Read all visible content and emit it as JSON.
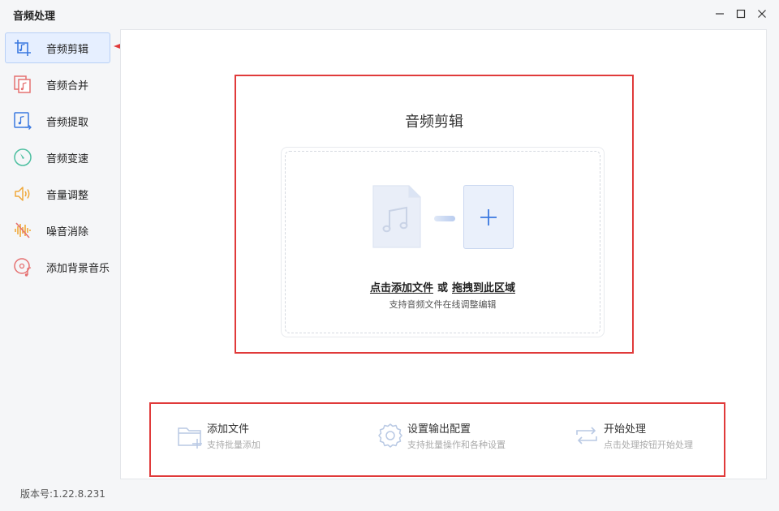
{
  "app": {
    "title": "音频处理"
  },
  "window_controls": {
    "minimize": "minimize-icon",
    "maximize": "maximize-icon",
    "close": "close-icon"
  },
  "sidebar": {
    "items": [
      {
        "label": "音频剪辑",
        "icon": "audio-clip-icon",
        "active": true
      },
      {
        "label": "音频合并",
        "icon": "audio-merge-icon",
        "active": false
      },
      {
        "label": "音频提取",
        "icon": "audio-extract-icon",
        "active": false
      },
      {
        "label": "音频变速",
        "icon": "audio-speed-icon",
        "active": false
      },
      {
        "label": "音量调整",
        "icon": "volume-icon",
        "active": false
      },
      {
        "label": "噪音消除",
        "icon": "noise-removal-icon",
        "active": false
      },
      {
        "label": "添加背景音乐",
        "icon": "background-music-icon",
        "active": false
      }
    ]
  },
  "upload": {
    "title": "音频剪辑",
    "click_add": "点击添加文件",
    "or": "或",
    "drag_here": "拖拽到此区域",
    "hint": "支持音频文件在线调整编辑"
  },
  "steps": [
    {
      "title": "添加文件",
      "desc": "支持批量添加",
      "icon": "folder-add-icon"
    },
    {
      "title": "设置输出配置",
      "desc": "支持批量操作和各种设置",
      "icon": "settings-icon"
    },
    {
      "title": "开始处理",
      "desc": "点击处理按钮开始处理",
      "icon": "process-icon"
    }
  ],
  "footer": {
    "version": "版本号:1.22.8.231"
  },
  "colors": {
    "accent": "#3a78e0",
    "annotation_red": "#e03a3a",
    "active_bg": "#e6efff"
  }
}
